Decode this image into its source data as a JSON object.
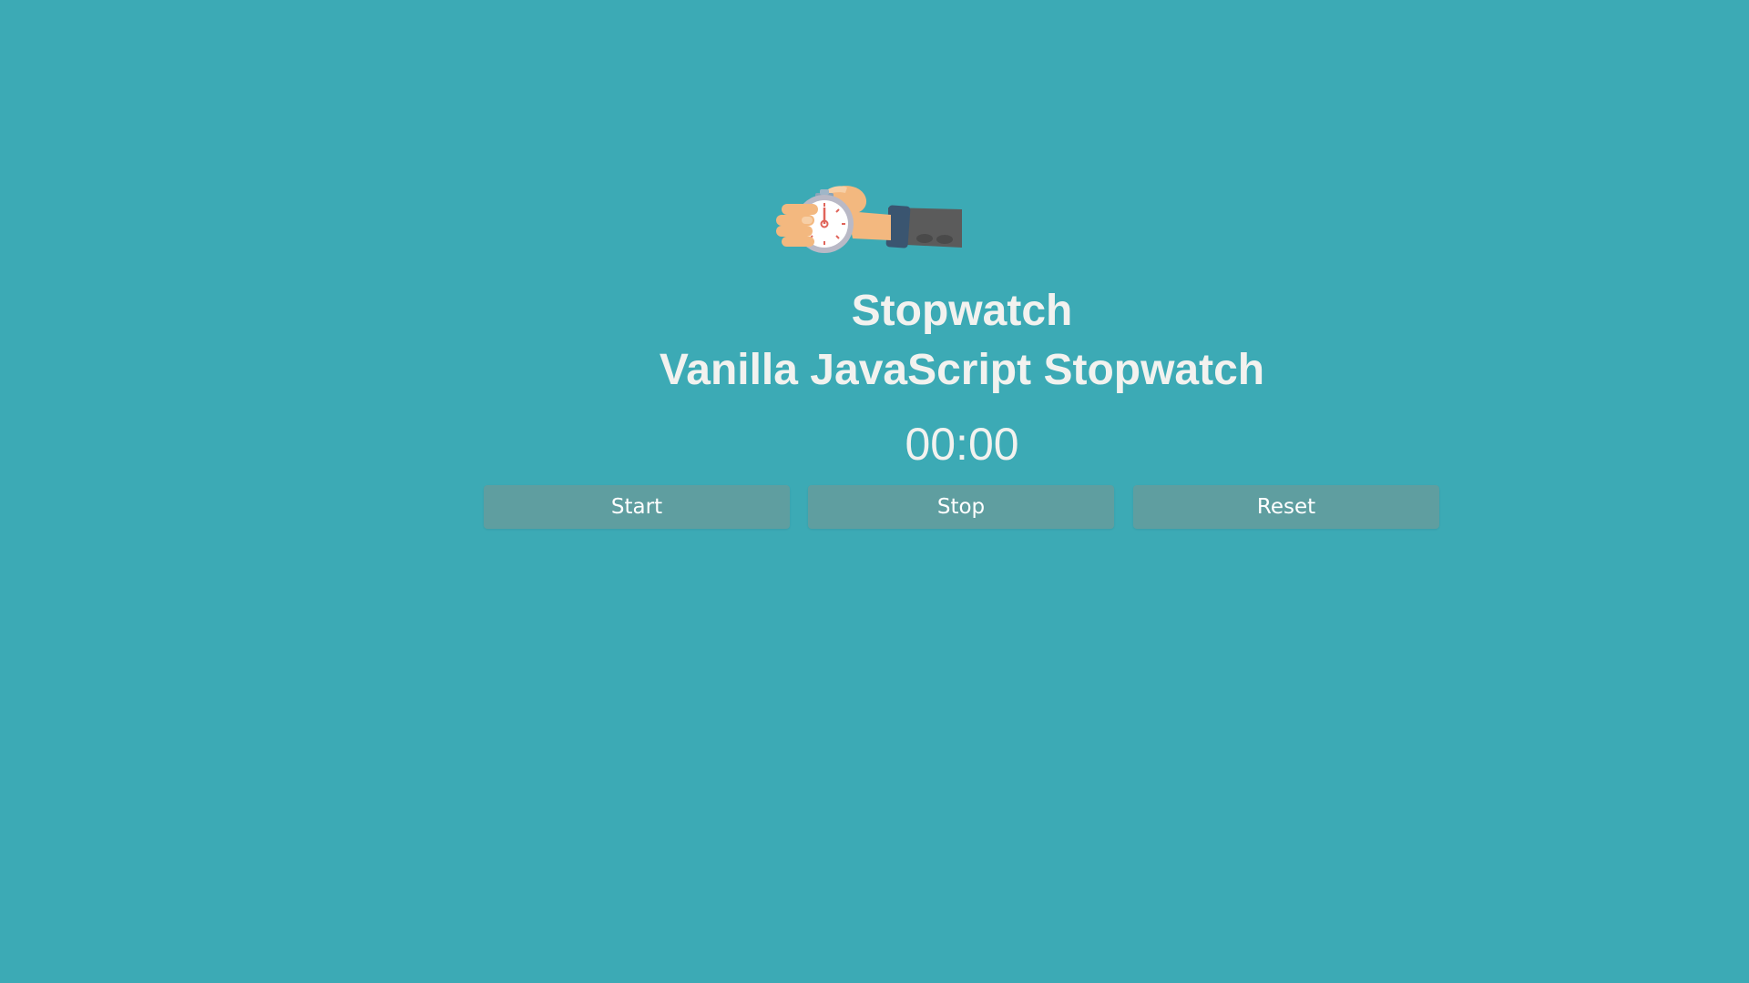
{
  "header": {
    "title": "Stopwatch",
    "subtitle": "Vanilla JavaScript Stopwatch"
  },
  "timer": {
    "display": "00:00"
  },
  "controls": {
    "start_label": "Start",
    "stop_label": "Stop",
    "reset_label": "Reset"
  },
  "illustration": {
    "icon": "hand-holding-stopwatch-icon"
  },
  "colors": {
    "background": "#3caab5",
    "button": "#5f9ea0",
    "text": "#f2f2ef"
  }
}
